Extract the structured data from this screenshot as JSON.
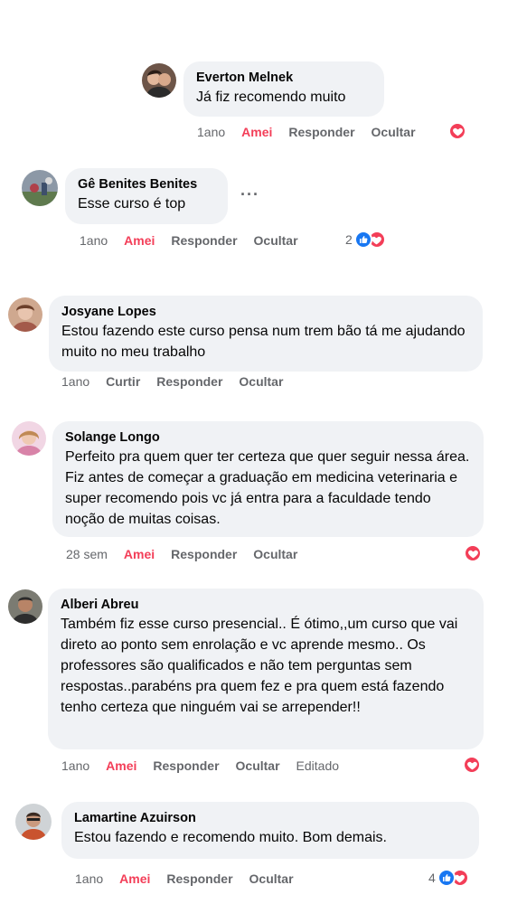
{
  "labels": {
    "amei": "Amei",
    "curtir": "Curtir",
    "responder": "Responder",
    "ocultar": "Ocultar",
    "editado": "Editado"
  },
  "colors": {
    "heart": "#f33e58",
    "like": "#1877f2",
    "bubble": "#f0f2f5",
    "muted": "#65676b"
  },
  "comments": [
    {
      "author": "Everton Melnek",
      "text": "Já fiz recomendo muito",
      "time": "1ano",
      "reaction_label": "Amei",
      "reactions": [
        "heart"
      ]
    },
    {
      "author": "Gê Benites Benites",
      "text": "Esse curso é top",
      "more": "···",
      "time": "1ano",
      "reaction_label": "Amei",
      "reaction_count": "2",
      "reactions": [
        "like",
        "heart"
      ]
    },
    {
      "author": "Josyane Lopes",
      "text": "Estou fazendo este curso pensa num trem bão tá me ajudando muito no meu trabalho",
      "time": "1ano",
      "reaction_label": "Curtir"
    },
    {
      "author": "Solange Longo",
      "text": "Perfeito pra quem quer ter certeza que quer seguir nessa área. Fiz antes de começar a graduação em medicina veterinaria e super recomendo pois vc já entra para a faculdade tendo noção de muitas coisas.",
      "time": "28 sem",
      "reaction_label": "Amei",
      "reactions": [
        "heart"
      ]
    },
    {
      "author": "Alberi Abreu",
      "text": "Também fiz esse curso presencial.. É ótimo,,um curso que vai direto ao ponto sem enrolação e vc aprende mesmo.. Os professores são qualificados e não tem perguntas sem respostas..parabéns pra quem fez e pra quem está fazendo tenho certeza que ninguém vai se arrepender!!",
      "time": "1ano",
      "reaction_label": "Amei",
      "edited": "Editado",
      "reactions": [
        "heart"
      ]
    },
    {
      "author": "Lamartine Azuirson",
      "text": "Estou fazendo e recomendo muito. Bom demais.",
      "time": "1ano",
      "reaction_label": "Amei",
      "reaction_count": "4",
      "reactions": [
        "like",
        "heart"
      ]
    }
  ]
}
